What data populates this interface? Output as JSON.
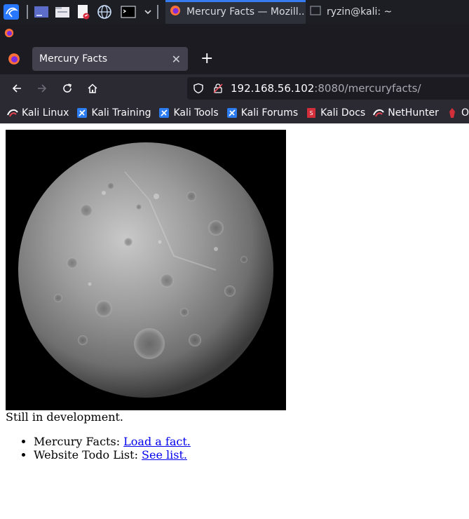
{
  "taskbar": {
    "tasks": [
      {
        "label": "Mercury Facts — Mozill...",
        "icon": "firefox-icon"
      },
      {
        "label": "ryzin@kali: ~",
        "icon": "terminal-icon"
      }
    ]
  },
  "browser": {
    "tab_title": "Mercury Facts",
    "url_host": "192.168.56.102",
    "url_path": ":8080/mercuryfacts/",
    "bookmarks": [
      {
        "label": "Kali Linux",
        "icon": "kali-icon"
      },
      {
        "label": "Kali Training",
        "icon": "kali-training-icon"
      },
      {
        "label": "Kali Tools",
        "icon": "kali-tools-icon"
      },
      {
        "label": "Kali Forums",
        "icon": "kali-forums-icon"
      },
      {
        "label": "Kali Docs",
        "icon": "kali-docs-icon"
      },
      {
        "label": "NetHunter",
        "icon": "nethunter-icon"
      },
      {
        "label": "Offen",
        "icon": "offsec-icon"
      }
    ]
  },
  "page": {
    "dev_note": "Still in development.",
    "facts": [
      {
        "label": "Mercury Facts: ",
        "link": "Load a fact."
      },
      {
        "label": "Website Todo List: ",
        "link": "See list."
      }
    ]
  },
  "colors": {
    "taskbar_bg": "#1c1e24",
    "browser_chrome": "#2b2a33",
    "tab_active": "#42414d",
    "accent": "#367bf0",
    "link": "#0000ee"
  }
}
